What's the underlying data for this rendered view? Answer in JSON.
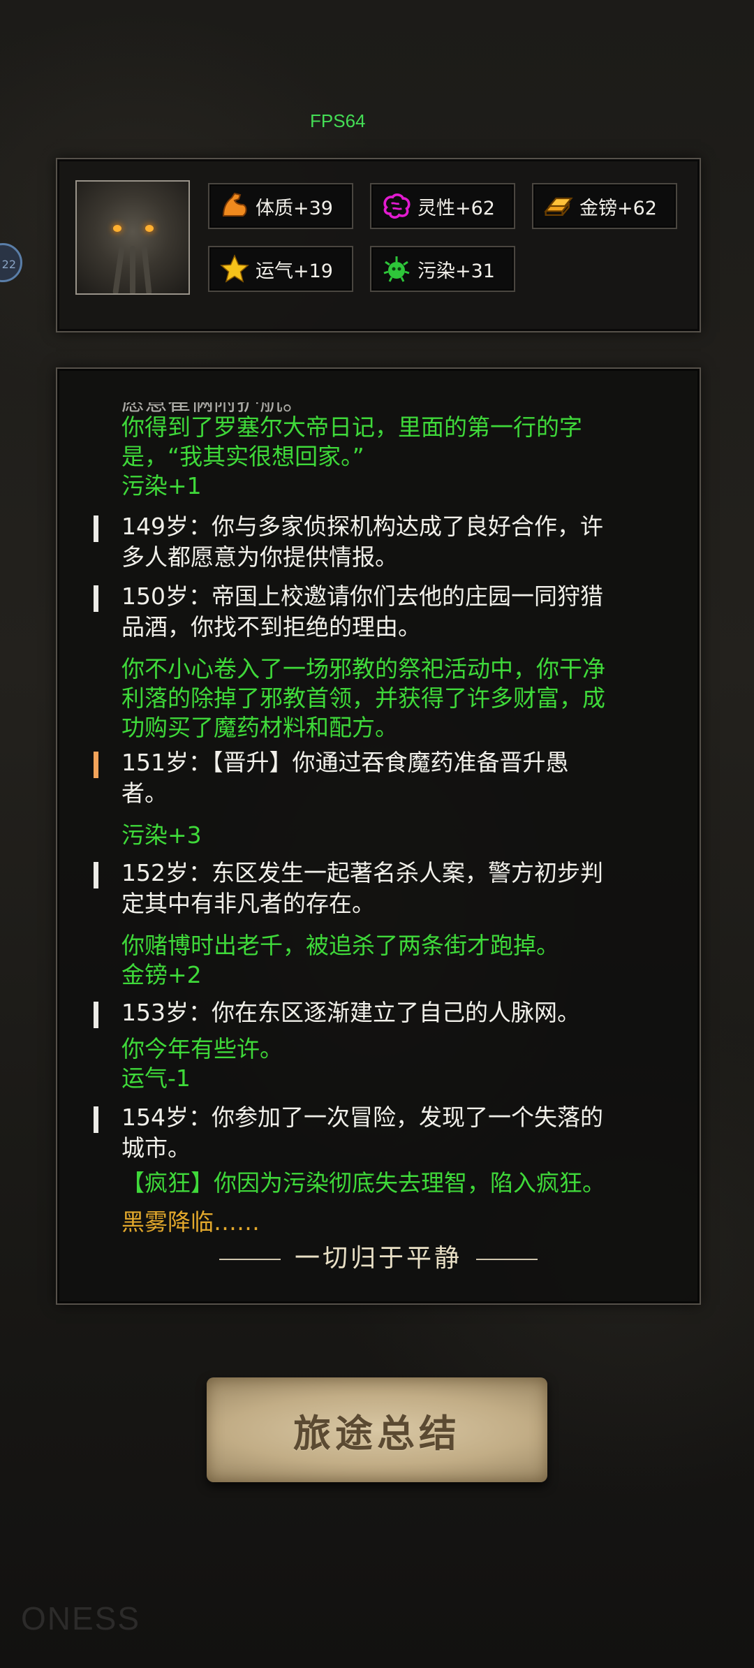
{
  "hud": {
    "fps": "FPS64",
    "side_badge": "22"
  },
  "stats": [
    {
      "icon": "muscle-icon",
      "label": "体质+39",
      "color": "#f08a1e"
    },
    {
      "icon": "brain-icon",
      "label": "灵性+62",
      "color": "#e21bd0"
    },
    {
      "icon": "gold-bar-icon",
      "label": "金镑+62",
      "color": "#f0a21c"
    },
    {
      "icon": "star-icon",
      "label": "运气+19",
      "color": "#f6c21a"
    },
    {
      "icon": "germ-icon",
      "label": "污染+31",
      "color": "#2ec63a"
    }
  ],
  "log": {
    "cut_line": "愿意崔俩附护航。",
    "entries": [
      {
        "type": "event",
        "text": [
          "你得到了罗塞尔大帝日记，里面的第一行的字",
          "是，“我其实很想回家。”"
        ]
      },
      {
        "type": "event",
        "text": [
          "污染+1"
        ]
      },
      {
        "type": "year",
        "text": [
          "149岁：你与多家侦探机构达成了良好合作，许",
          "多人都愿意为你提供情报。"
        ]
      },
      {
        "type": "year",
        "text": [
          "150岁：帝国上校邀请你们去他的庄园一同狩猎",
          "品酒，你找不到拒绝的理由。"
        ]
      },
      {
        "type": "event",
        "text": [
          "你不小心卷入了一场邪教的祭祀活动中，你干净",
          "利落的除掉了邪教首领，并获得了许多财富，成",
          "功购买了魔药材料和配方。"
        ]
      },
      {
        "type": "year-promo",
        "text": [
          "151岁：【晋升】你通过吞食魔药准备晋升愚",
          "者。"
        ]
      },
      {
        "type": "event",
        "text": [
          "污染+3"
        ]
      },
      {
        "type": "year",
        "text": [
          "152岁：东区发生一起著名杀人案，警方初步判",
          "定其中有非凡者的存在。"
        ]
      },
      {
        "type": "event",
        "text": [
          "你赌博时出老千，被追杀了两条街才跑掉。",
          "金镑+2"
        ]
      },
      {
        "type": "year",
        "text": [
          "153岁：你在东区逐渐建立了自己的人脉网。"
        ]
      },
      {
        "type": "event",
        "text": [
          "你今年有些许。",
          "运气-1"
        ]
      },
      {
        "type": "year",
        "text": [
          "154岁：你参加了一次冒险，发现了一个失落的",
          "城市。"
        ]
      },
      {
        "type": "event",
        "text": [
          "【疯狂】你因为污染彻底失去理智，陷入疯狂。"
        ]
      },
      {
        "type": "gold",
        "text": [
          "黑雾降临……"
        ]
      }
    ],
    "end_text": "一切归于平静"
  },
  "button": {
    "label": "旅途总结"
  },
  "watermark": "ONESS"
}
